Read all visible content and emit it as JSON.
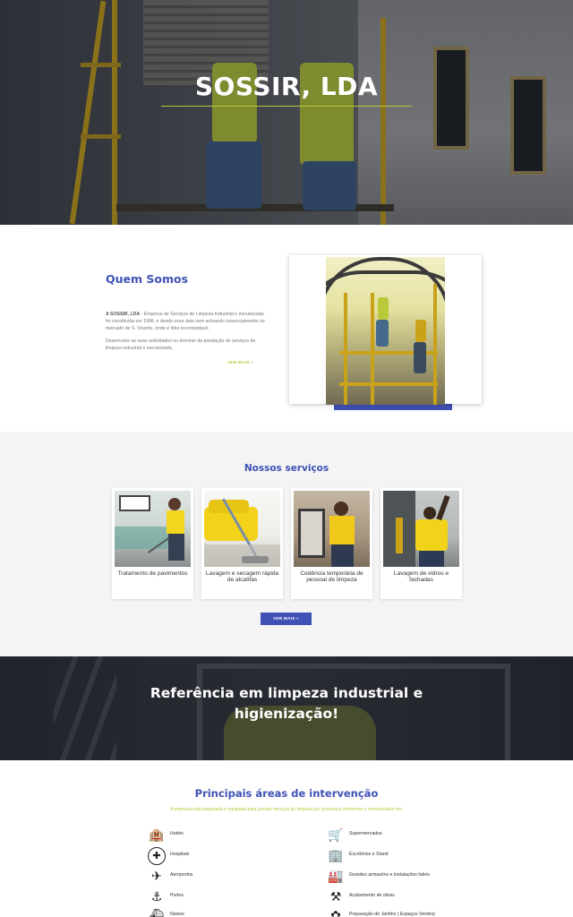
{
  "hero": {
    "title": "SOSSIR, LDA"
  },
  "about": {
    "heading": "Quem Somos",
    "p1_company": "A SOSSIR, LDA",
    "p1_text": " - Empresa de  Serviços de Limpeza Industrial e mecanizada foi constituída em 1996,  e desde essa data vem actuando essencialmente no mercado de S. Vicente, onde é líder incontestável.",
    "p2": "Desenvolve as suas actividades no domínio da prestação de serviços de limpeza industrial e mecanizada.",
    "more": "VER MAIS »"
  },
  "services": {
    "heading": "Nossos serviços",
    "items": [
      {
        "title": "Tratamento de pavimentos"
      },
      {
        "title": "Lavagem e secagem rápida de alcatifas"
      },
      {
        "title": "Cedência temporária de pessoal de limpeza"
      },
      {
        "title": "Lavagem de vidros e fachadas"
      }
    ],
    "more": "VER MAIS »"
  },
  "banner": {
    "text": "Referência em limpeza industrial e higienização!"
  },
  "areas": {
    "heading": "Principais áreas de intervenção",
    "subtitle": "A empresa está preparada e equipada para prestar serviços de limpeza por processos modernos e mecanizados em:",
    "left": [
      {
        "label": "Hotéis",
        "icon": "hotel-icon",
        "glyph": "🏨"
      },
      {
        "label": "Hospitais",
        "icon": "hospital-icon",
        "glyph": "✚"
      },
      {
        "label": "Aeroportos",
        "icon": "airplane-icon",
        "glyph": "✈"
      },
      {
        "label": "Portos",
        "icon": "anchor-icon",
        "glyph": "⚓"
      },
      {
        "label": "Navios",
        "icon": "ship-icon",
        "glyph": "⛴"
      }
    ],
    "right": [
      {
        "label": "Supermercados",
        "icon": "shopping-cart-icon",
        "glyph": "🛒"
      },
      {
        "label": "Escritórios e Stand",
        "icon": "office-icon",
        "glyph": "🏢"
      },
      {
        "label": "Grandes armazéns e instalações fabris",
        "icon": "factory-icon",
        "glyph": "🏭"
      },
      {
        "label": "Acabamento de obras",
        "icon": "construction-icon",
        "glyph": "⚒"
      },
      {
        "label": "Preparação de Jardins ( Espaços Verdes)",
        "icon": "garden-icon",
        "glyph": "✿"
      }
    ]
  },
  "colors": {
    "brand_blue": "#3f51b5",
    "accent_green": "#b9c93a"
  }
}
